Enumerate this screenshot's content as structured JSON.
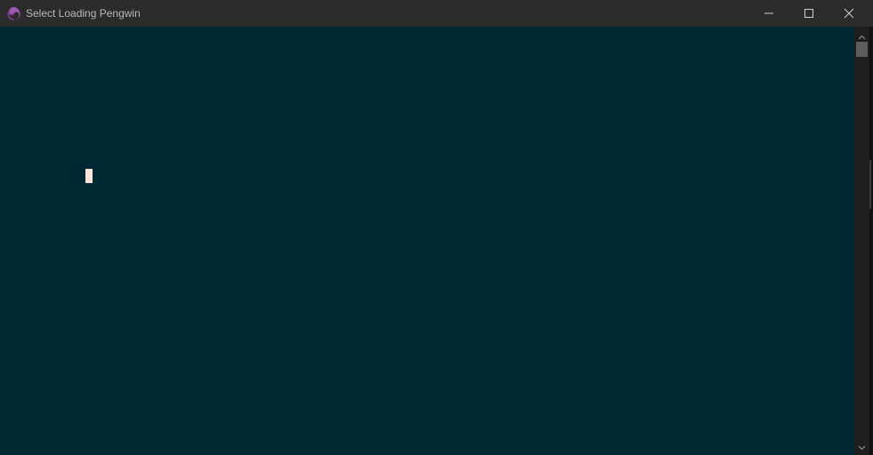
{
  "window": {
    "title": "Select Loading Pengwin",
    "app_icon": "pengwin-swirl-icon",
    "controls": {
      "minimize_icon": "minimize-icon",
      "maximize_icon": "maximize-icon",
      "close_icon": "close-icon"
    }
  },
  "terminal": {
    "background": "#002832",
    "cursor_color": "#fde3d8"
  },
  "scrollbar": {
    "up_icon": "chevron-up-icon",
    "down_icon": "chevron-down-icon"
  }
}
